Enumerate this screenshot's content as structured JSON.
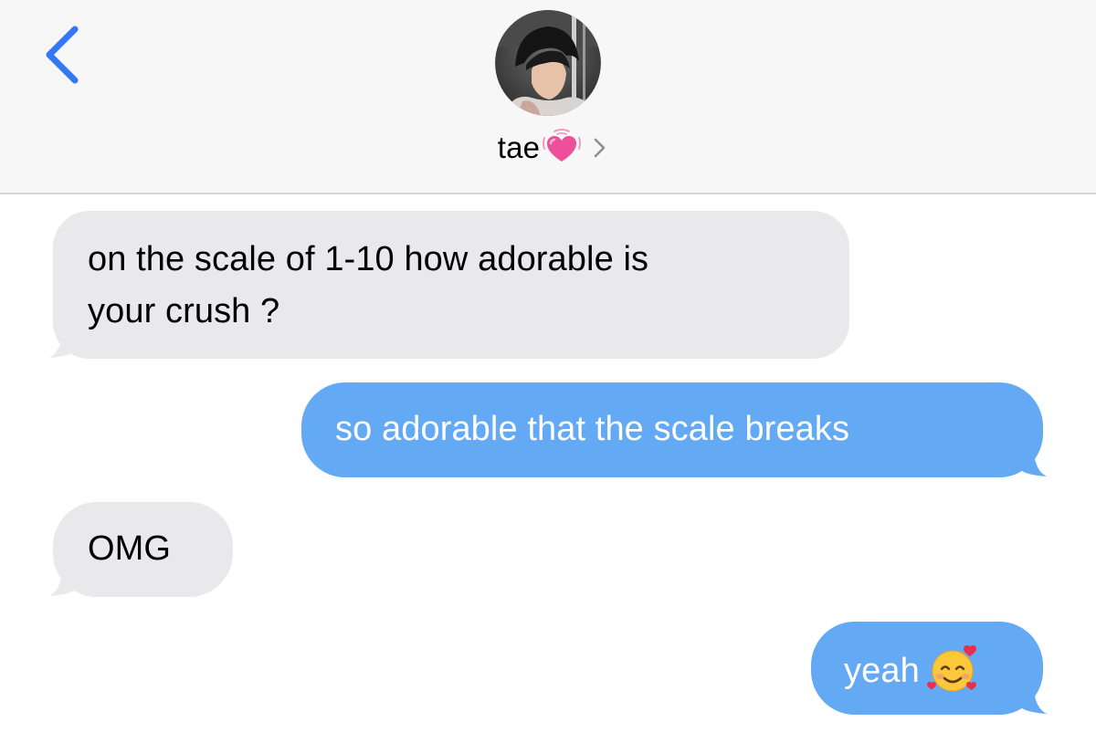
{
  "header": {
    "contact_name": "tae",
    "contact_emoji": "growing-heart-icon",
    "avatar": "contact-avatar-photo",
    "back_icon": "chevron-left-icon",
    "details_icon": "chevron-right-icon"
  },
  "messages": [
    {
      "direction": "received",
      "lines": [
        "on the scale of 1-10 how adorable is",
        "your crush ?"
      ]
    },
    {
      "direction": "sent",
      "text": "so adorable that the scale breaks"
    },
    {
      "direction": "received",
      "text": "OMG"
    },
    {
      "direction": "sent",
      "text": "yeah",
      "emoji": "smiling-face-with-hearts-icon"
    }
  ],
  "colors": {
    "header_bg": "#f7f7f7",
    "received_bubble": "#e9e9eb",
    "sent_bubble": "#64a9f4",
    "accent": "#3478f6",
    "heart": "#ee4f9b"
  }
}
